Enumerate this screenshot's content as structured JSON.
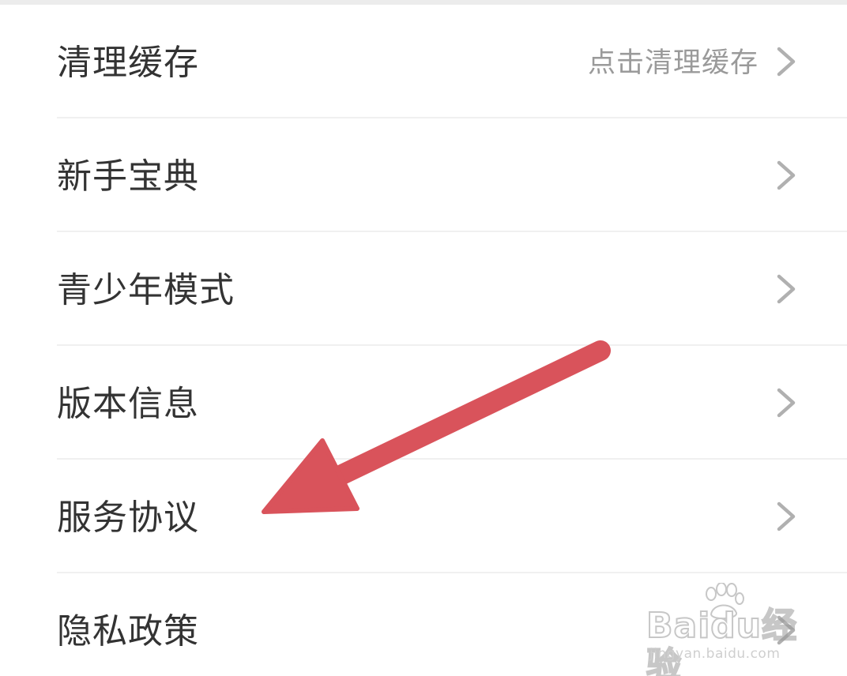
{
  "settings": {
    "items": [
      {
        "label": "清理缓存",
        "value": "点击清理缓存"
      },
      {
        "label": "新手宝典",
        "value": ""
      },
      {
        "label": "青少年模式",
        "value": ""
      },
      {
        "label": "版本信息",
        "value": ""
      },
      {
        "label": "服务协议",
        "value": ""
      },
      {
        "label": "隐私政策",
        "value": ""
      }
    ]
  },
  "annotation": {
    "arrow_color": "#d9535b",
    "points_to": "服务协议"
  },
  "watermark": {
    "brand": "Baidu经验",
    "url": "jingyan.baidu.com"
  },
  "colors": {
    "label_text": "#333333",
    "value_text": "#9a9a9a",
    "chevron": "#b0b0b0",
    "divider": "#f0f0f0",
    "background": "#ffffff"
  },
  "icons": {
    "row_chevron": "chevron-right-icon",
    "watermark_logo": "baidu-paw-icon"
  }
}
